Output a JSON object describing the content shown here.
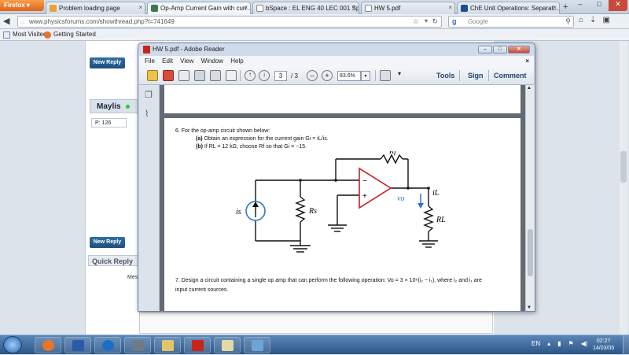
{
  "browser": {
    "menu_button": "Firefox",
    "tabs": [
      {
        "label": "Problem loading page",
        "active": false
      },
      {
        "label": "Op-Amp Current Gain with curr...",
        "active": true
      },
      {
        "label": "bSpace : EL ENG 40 LEC 001 Sp1...",
        "active": false
      },
      {
        "label": "HW 5.pdf",
        "active": false
      },
      {
        "label": "ChE Unit Operations: Separati...",
        "active": false
      }
    ],
    "new_tab": "+",
    "url": "www.physicsforums.com/showthread.php?t=741649",
    "search_placeholder": "Google",
    "search_engine_glyph": "g",
    "bookmarks": [
      "Most Visited",
      "Getting Started"
    ]
  },
  "forum": {
    "new_reply_label": "New Reply",
    "user_name": "Maylis",
    "posts": "P: 126",
    "quick_reply": "Quick Reply",
    "message_label": "Mess"
  },
  "reader": {
    "title": "HW 5.pdf - Adobe Reader",
    "menu": [
      "File",
      "Edit",
      "View",
      "Window",
      "Help"
    ],
    "page_current": "3",
    "page_total": "/ 3",
    "zoom": "83.6%",
    "toolbar_links": [
      "Tools",
      "Sign",
      "Comment"
    ]
  },
  "problem6": {
    "intro": "6. For the op-amp circuit shown below:",
    "a_label": "(a)",
    "a_text": "Obtain an expression for the current gain Gi = iL/is.",
    "b_label": "(b)",
    "b_text": "If RL = 12 kΩ, choose Rf so that Gi = −15.",
    "circuit": {
      "rf": "Rf",
      "is": "is",
      "rs": "Rs",
      "vo": "vo",
      "il": "iL",
      "rl": "RL",
      "minus": "−",
      "plus": "+"
    }
  },
  "problem7": {
    "line1": "7.  Design a circuit containing a single op amp that can perform the following operation: Vo = 3 × 10⁶(i₂ − i₁), where i₂ and i₁ are",
    "line2": "input current sources."
  },
  "taskbar": {
    "lang": "EN",
    "time": "02:27",
    "date": "14/03/05"
  },
  "colors": {
    "opamp": "#c8201f",
    "current_source": "#2a78c8",
    "arrow_il": "#2a78c8",
    "taskbar": "#2c5687",
    "new_reply": "#1e4f7c"
  }
}
